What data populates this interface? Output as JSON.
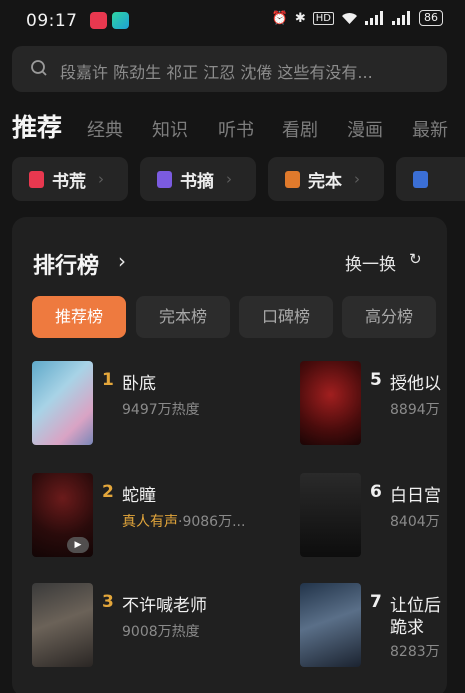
{
  "status_bar": {
    "time": "09:17",
    "battery": "86"
  },
  "search": {
    "placeholder": "段嘉许 陈劲生 祁正 江忍 沈倦 这些有没有..."
  },
  "category_tabs": [
    "推荐",
    "经典",
    "知识",
    "听书",
    "看剧",
    "漫画",
    "最新"
  ],
  "chips": [
    {
      "label": "书荒",
      "icon_color": "#e8384f"
    },
    {
      "label": "书摘",
      "icon_color": "#7b5be0"
    },
    {
      "label": "完本",
      "icon_color": "#e07a2c"
    },
    {
      "label": "",
      "icon_color": "#3b6fd6"
    }
  ],
  "ranking": {
    "title": "排行榜",
    "refresh_label": "换一换",
    "tabs": [
      "推荐榜",
      "完本榜",
      "口碑榜",
      "高分榜"
    ],
    "books_left": [
      {
        "rank": "1",
        "title": "卧底",
        "meta": "9497万热度"
      },
      {
        "rank": "2",
        "title": "蛇瞳",
        "tag": "真人有声",
        "meta": "·9086万..."
      },
      {
        "rank": "3",
        "title": "不许喊老师",
        "meta": "9008万热度"
      }
    ],
    "books_right": [
      {
        "rank": "5",
        "title": "授他以",
        "meta": "8894万"
      },
      {
        "rank": "6",
        "title": "白日宫",
        "meta": "8404万"
      },
      {
        "rank": "7",
        "title": "让位后",
        "title2": "跪求",
        "meta": "8283万"
      }
    ]
  },
  "colors": {
    "accent": "#ee7a3f",
    "rank_gold": "#e3a63b",
    "background": "#151515",
    "card": "#202020"
  }
}
